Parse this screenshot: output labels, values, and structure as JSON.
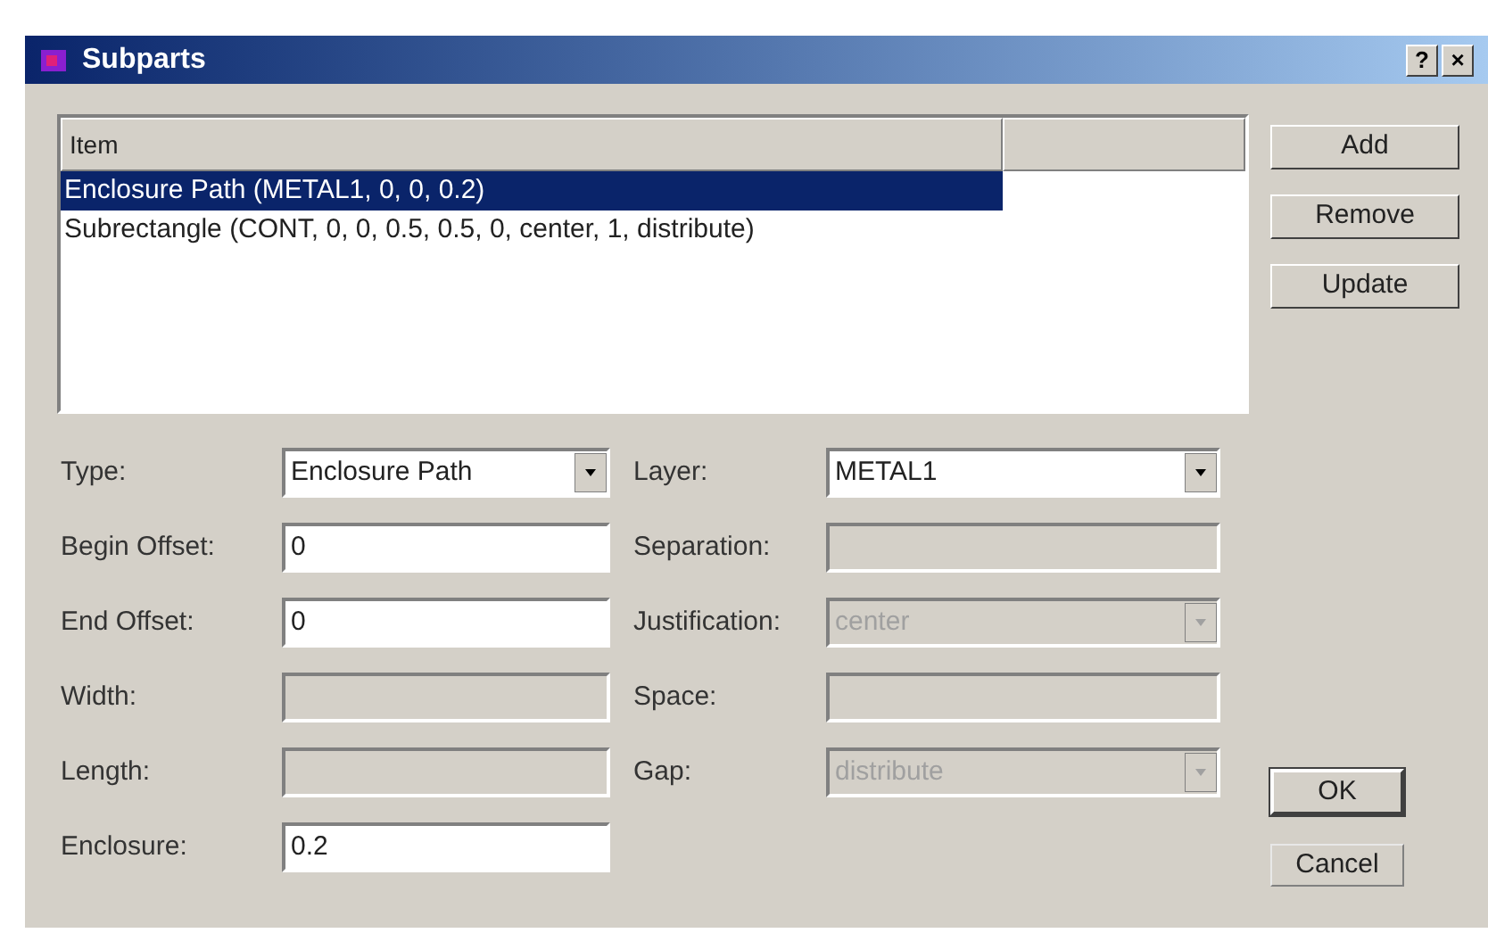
{
  "window": {
    "title": "Subparts",
    "title_buttons": [
      "?",
      "×"
    ]
  },
  "list": {
    "columns": [
      "Item"
    ],
    "rows": [
      {
        "text": "Enclosure Path (METAL1, 0, 0, 0.2)",
        "selected": true
      },
      {
        "text": "Subrectangle (CONT, 0, 0, 0.5, 0.5, 0, center, 1, distribute)",
        "selected": false
      }
    ]
  },
  "side_buttons": [
    "Add",
    "Remove",
    "Update"
  ],
  "form": {
    "left": [
      {
        "label": "Type:",
        "kind": "dropdown",
        "value": "Enclosure Path",
        "disabled": false
      },
      {
        "label": "Begin Offset:",
        "kind": "text",
        "value": "0",
        "disabled": false
      },
      {
        "label": "End Offset:",
        "kind": "text",
        "value": "0",
        "disabled": false
      },
      {
        "label": "Width:",
        "kind": "text",
        "disabled": true
      },
      {
        "label": "Length:",
        "kind": "text",
        "disabled": true
      },
      {
        "label": "Enclosure:",
        "kind": "text",
        "value": "0.2",
        "disabled": false
      }
    ],
    "right": [
      {
        "label": "Layer:",
        "kind": "dropdown",
        "value": "METAL1",
        "disabled": false
      },
      {
        "label": "Separation:",
        "kind": "text",
        "disabled": true
      },
      {
        "label": "Justification:",
        "kind": "dropdown",
        "value": "center",
        "disabled": true
      },
      {
        "label": "Space:",
        "kind": "text",
        "disabled": true
      },
      {
        "label": "Gap:",
        "kind": "dropdown",
        "value": "distribute",
        "disabled": true
      }
    ]
  },
  "dialog_buttons": [
    {
      "label": "OK",
      "default": true
    },
    {
      "label": "Cancel",
      "default": false
    }
  ]
}
